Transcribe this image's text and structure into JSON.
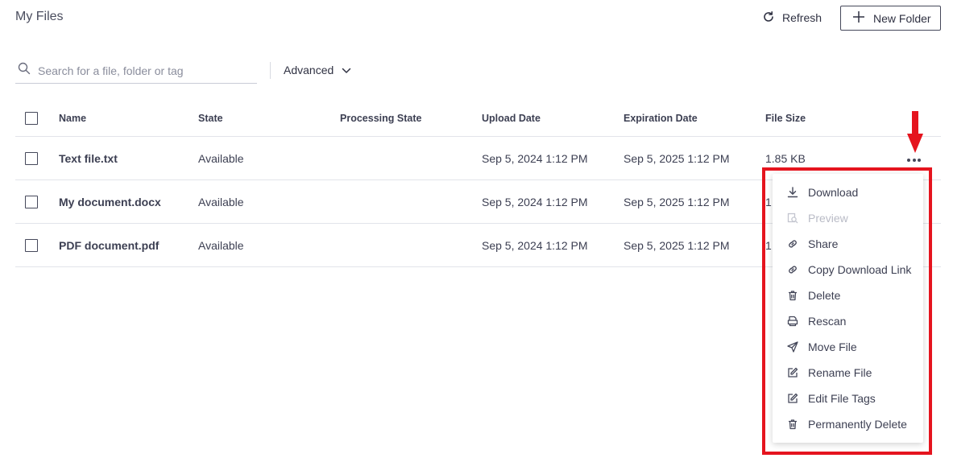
{
  "page": {
    "title": "My Files"
  },
  "toolbar": {
    "refresh_label": "Refresh",
    "new_folder_label": "New Folder"
  },
  "search": {
    "placeholder": "Search for a file, folder or tag",
    "value": "",
    "advanced_label": "Advanced"
  },
  "table": {
    "columns": [
      "Name",
      "State",
      "Processing State",
      "Upload Date",
      "Expiration Date",
      "File Size"
    ],
    "rows": [
      {
        "name": "Text file.txt",
        "state": "Available",
        "processing_state": "",
        "upload_date": "Sep 5, 2024 1:12 PM",
        "expiration_date": "Sep 5, 2025 1:12 PM",
        "file_size": "1.85 KB"
      },
      {
        "name": "My document.docx",
        "state": "Available",
        "processing_state": "",
        "upload_date": "Sep 5, 2024 1:12 PM",
        "expiration_date": "Sep 5, 2025 1:12 PM",
        "file_size": "1"
      },
      {
        "name": "PDF document.pdf",
        "state": "Available",
        "processing_state": "",
        "upload_date": "Sep 5, 2024 1:12 PM",
        "expiration_date": "Sep 5, 2025 1:12 PM",
        "file_size": "1"
      }
    ]
  },
  "context_menu": {
    "items": [
      {
        "label": "Download",
        "icon": "download-icon",
        "disabled": false
      },
      {
        "label": "Preview",
        "icon": "preview-icon",
        "disabled": true
      },
      {
        "label": "Share",
        "icon": "link-icon",
        "disabled": false
      },
      {
        "label": "Copy Download Link",
        "icon": "link-icon",
        "disabled": false
      },
      {
        "label": "Delete",
        "icon": "trash-icon",
        "disabled": false
      },
      {
        "label": "Rescan",
        "icon": "rescan-icon",
        "disabled": false
      },
      {
        "label": "Move File",
        "icon": "send-icon",
        "disabled": false
      },
      {
        "label": "Rename File",
        "icon": "edit-icon",
        "disabled": false
      },
      {
        "label": "Edit File Tags",
        "icon": "edit-icon",
        "disabled": false
      },
      {
        "label": "Permanently Delete",
        "icon": "trash-icon",
        "disabled": false
      }
    ]
  },
  "colors": {
    "text": "#3c3f52",
    "disabled": "#b9bbc6",
    "highlight": "#e5141e",
    "border": "#e2e4ea"
  }
}
